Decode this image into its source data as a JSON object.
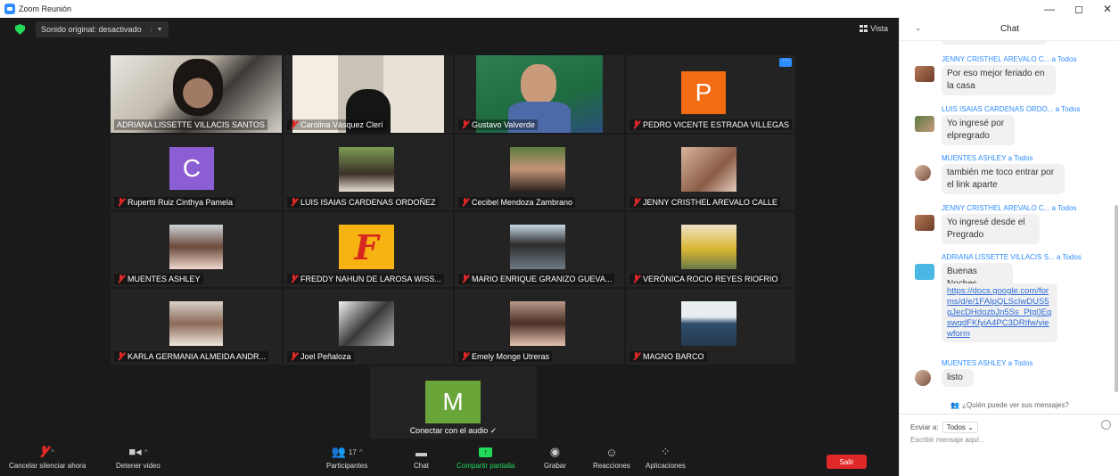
{
  "window": {
    "title": "Zoom Reunión",
    "controls": [
      "—",
      "◻",
      "✕"
    ]
  },
  "topbar": {
    "sound": "Sonido original: desactivado",
    "view": "Vista"
  },
  "tiles": [
    {
      "name": "ADRIANA LISSETTE VILLACIS SANTOS",
      "muted": false
    },
    {
      "name": "Carolina Vásquez Clerí",
      "muted": true
    },
    {
      "name": "Gustavo Valverde",
      "muted": true
    },
    {
      "name": "PEDRO VICENTE ESTRADA VILLEGAS",
      "muted": true,
      "initial": "P"
    },
    {
      "name": "Rupertti Ruiz Cinthya Pamela",
      "muted": true,
      "initial": "C"
    },
    {
      "name": "LUIS ISAIAS CARDENAS ORDOÑEZ",
      "muted": true
    },
    {
      "name": "Cecibel Mendoza Zambrano",
      "muted": true
    },
    {
      "name": "JENNY CRISTHEL AREVALO CALLE",
      "muted": true
    },
    {
      "name": "MUENTES ASHLEY",
      "muted": true
    },
    {
      "name": "FREDDY NAHUN DE LAROSA WISS...",
      "muted": true
    },
    {
      "name": "MARIO ENRIQUE GRANIZO GUEVA...",
      "muted": true
    },
    {
      "name": "VERÓNICA ROCIO REYES RIOFRIO",
      "muted": true
    },
    {
      "name": "KARLA GERMANIA ALMEIDA ANDR...",
      "muted": true
    },
    {
      "name": "Joel Peñaloza",
      "muted": true
    },
    {
      "name": "Emely Monge Utreras",
      "muted": true
    },
    {
      "name": "MAGNO BARCO",
      "muted": true
    },
    {
      "name": "Conectar con el audio ✓",
      "muted": false,
      "initial": "M"
    }
  ],
  "toolbar": {
    "mute": "Cancelar silenciar ahora",
    "video": "Detener video",
    "participants": "Participantes",
    "participants_count": "17",
    "chat": "Chat",
    "share": "Compartir pantalla",
    "record": "Grabar",
    "reactions": "Reacciones",
    "apps": "Aplicaciones",
    "leave": "Salir"
  },
  "chat": {
    "title": "Chat",
    "to_all": "a Todos",
    "messages": [
      {
        "from": "JENNY CRISTHEL AREVALO C...",
        "text": "Por eso mejor feriado en la casa"
      },
      {
        "from": "LUIS ISAIAS CARDENAS ORDO...",
        "text": "Yo ingresé por elpregrado"
      },
      {
        "from": "MUENTES ASHLEY",
        "text": "también me toco entrar por el link aparte"
      },
      {
        "from": "JENNY CRISTHEL AREVALO C...",
        "text": "Yo ingresé desde el Pregrado"
      },
      {
        "from": "ADRIANA LISSETTE VILLACIS S...",
        "text": "Buenas Noches",
        "link": "https://docs.google.com/forms/d/e/1FAIpQLScIwDUS5gJecDHdozbJn5Ss_Ptg0EqswqdFKfyiA4PC3DRIfw/viewform"
      },
      {
        "from": "MUENTES ASHLEY",
        "text": "listo"
      }
    ],
    "who_sees": "¿Quién puede ver sus mensajes?",
    "send_to_label": "Enviar a:",
    "send_to_value": "Todos",
    "placeholder": "Escribir mensaje aquí..."
  },
  "colors": {
    "zoom_blue": "#2d8cff",
    "meeting_bg": "#1a1a1a",
    "active_speaker": "#cde05a",
    "muted_red": "#e02828",
    "share_green": "#23d959",
    "avatar_orange": "#f36b12",
    "avatar_purple": "#8b5fd3",
    "avatar_green": "#69a539"
  }
}
